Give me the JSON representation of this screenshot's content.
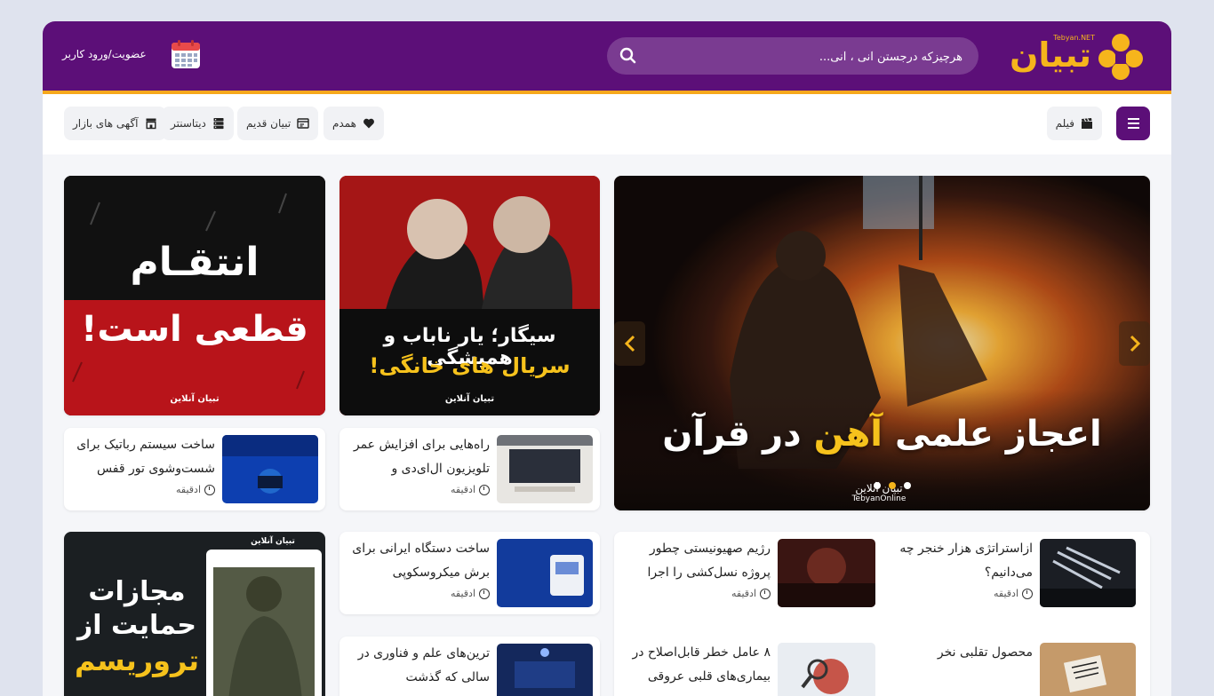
{
  "header": {
    "logo_text": "تبیان",
    "logo_sub": "Tebyan.NET",
    "search_placeholder": "هرچیزکه درجستن آنی ، آنی...",
    "login_label": "عضویت/ورود کاربر"
  },
  "nav": {
    "items": [
      {
        "label": "فیلم",
        "icon": "clapperboard-icon"
      },
      {
        "label": "همدم",
        "icon": "heart-icon"
      },
      {
        "label": "تبیان قدیم",
        "icon": "window-icon"
      },
      {
        "label": "دیتاسنتر",
        "icon": "server-icon"
      },
      {
        "label": "آگهی های بازار",
        "icon": "store-icon"
      }
    ]
  },
  "hero": {
    "title_part1": "اعجاز علمی",
    "title_part2": "آهن",
    "title_part3": "در قرآن",
    "brand": "تبیان آنلاین",
    "brand_en": "TebyanOnline"
  },
  "posters": [
    {
      "line1": "سیگار؛ یار ناباب و همیشگی",
      "line2": "سریال های خانگی!",
      "brand": "تبیان آنلاین"
    },
    {
      "line1": "انتقـام",
      "line2": "قطعی است!",
      "brand": "تبیان آنلاین"
    },
    {
      "line1": "مجازات",
      "line2": "حمایت از",
      "line3": "تروریسم",
      "brand": "تبیان آنلاین"
    }
  ],
  "news": [
    {
      "title": "راه‌هایی برای افزایش عمر تلویزیون ال‌ای‌دی و",
      "time": "ادقیقه"
    },
    {
      "title": "ساخت سیستم رباتیک برای شست‌وشوی تور قفس",
      "time": "ادقیقه"
    },
    {
      "title": "ساخت دستگاه ایرانی برای برش میکروسکوپی",
      "time": "ادقیقه"
    },
    {
      "title": "ترین‌های علم و فناوری در سالی که گذشت",
      "time": ""
    },
    {
      "title": "ازاستراتژی هزار خنجر چه می‌دانیم؟",
      "time": "ادقیقه"
    },
    {
      "title": "رژیم صهیونیستی چطور پروژه نسل‌کشی را اجرا",
      "time": "ادقیقه"
    },
    {
      "title": "محصول تقلبی نخر",
      "time": ""
    },
    {
      "title": "۸ عامل خطر قابل‌اصلاح در بیماری‌های قلبی عروقی",
      "time": ""
    }
  ],
  "colors": {
    "brand_purple": "#5c0f78",
    "brand_orange": "#f6a81c"
  }
}
